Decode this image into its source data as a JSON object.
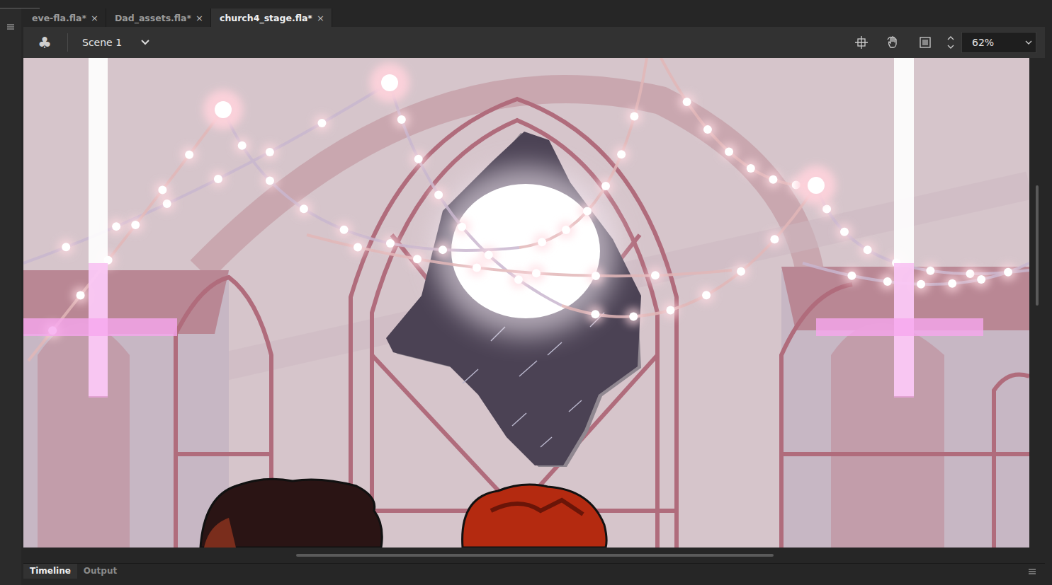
{
  "tabs": [
    {
      "label": "eve-fla.fla*",
      "close": "×",
      "selected": false
    },
    {
      "label": "Dad_assets.fla*",
      "close": "×",
      "selected": false
    },
    {
      "label": "church4_stage.fla*",
      "close": "×",
      "selected": true
    }
  ],
  "toolbar": {
    "scene_icon": "♣",
    "scene": "Scene 1",
    "zoom": "62%"
  },
  "panel_tabs": [
    {
      "label": "Timeline",
      "selected": true
    },
    {
      "label": "Output",
      "selected": false
    }
  ]
}
